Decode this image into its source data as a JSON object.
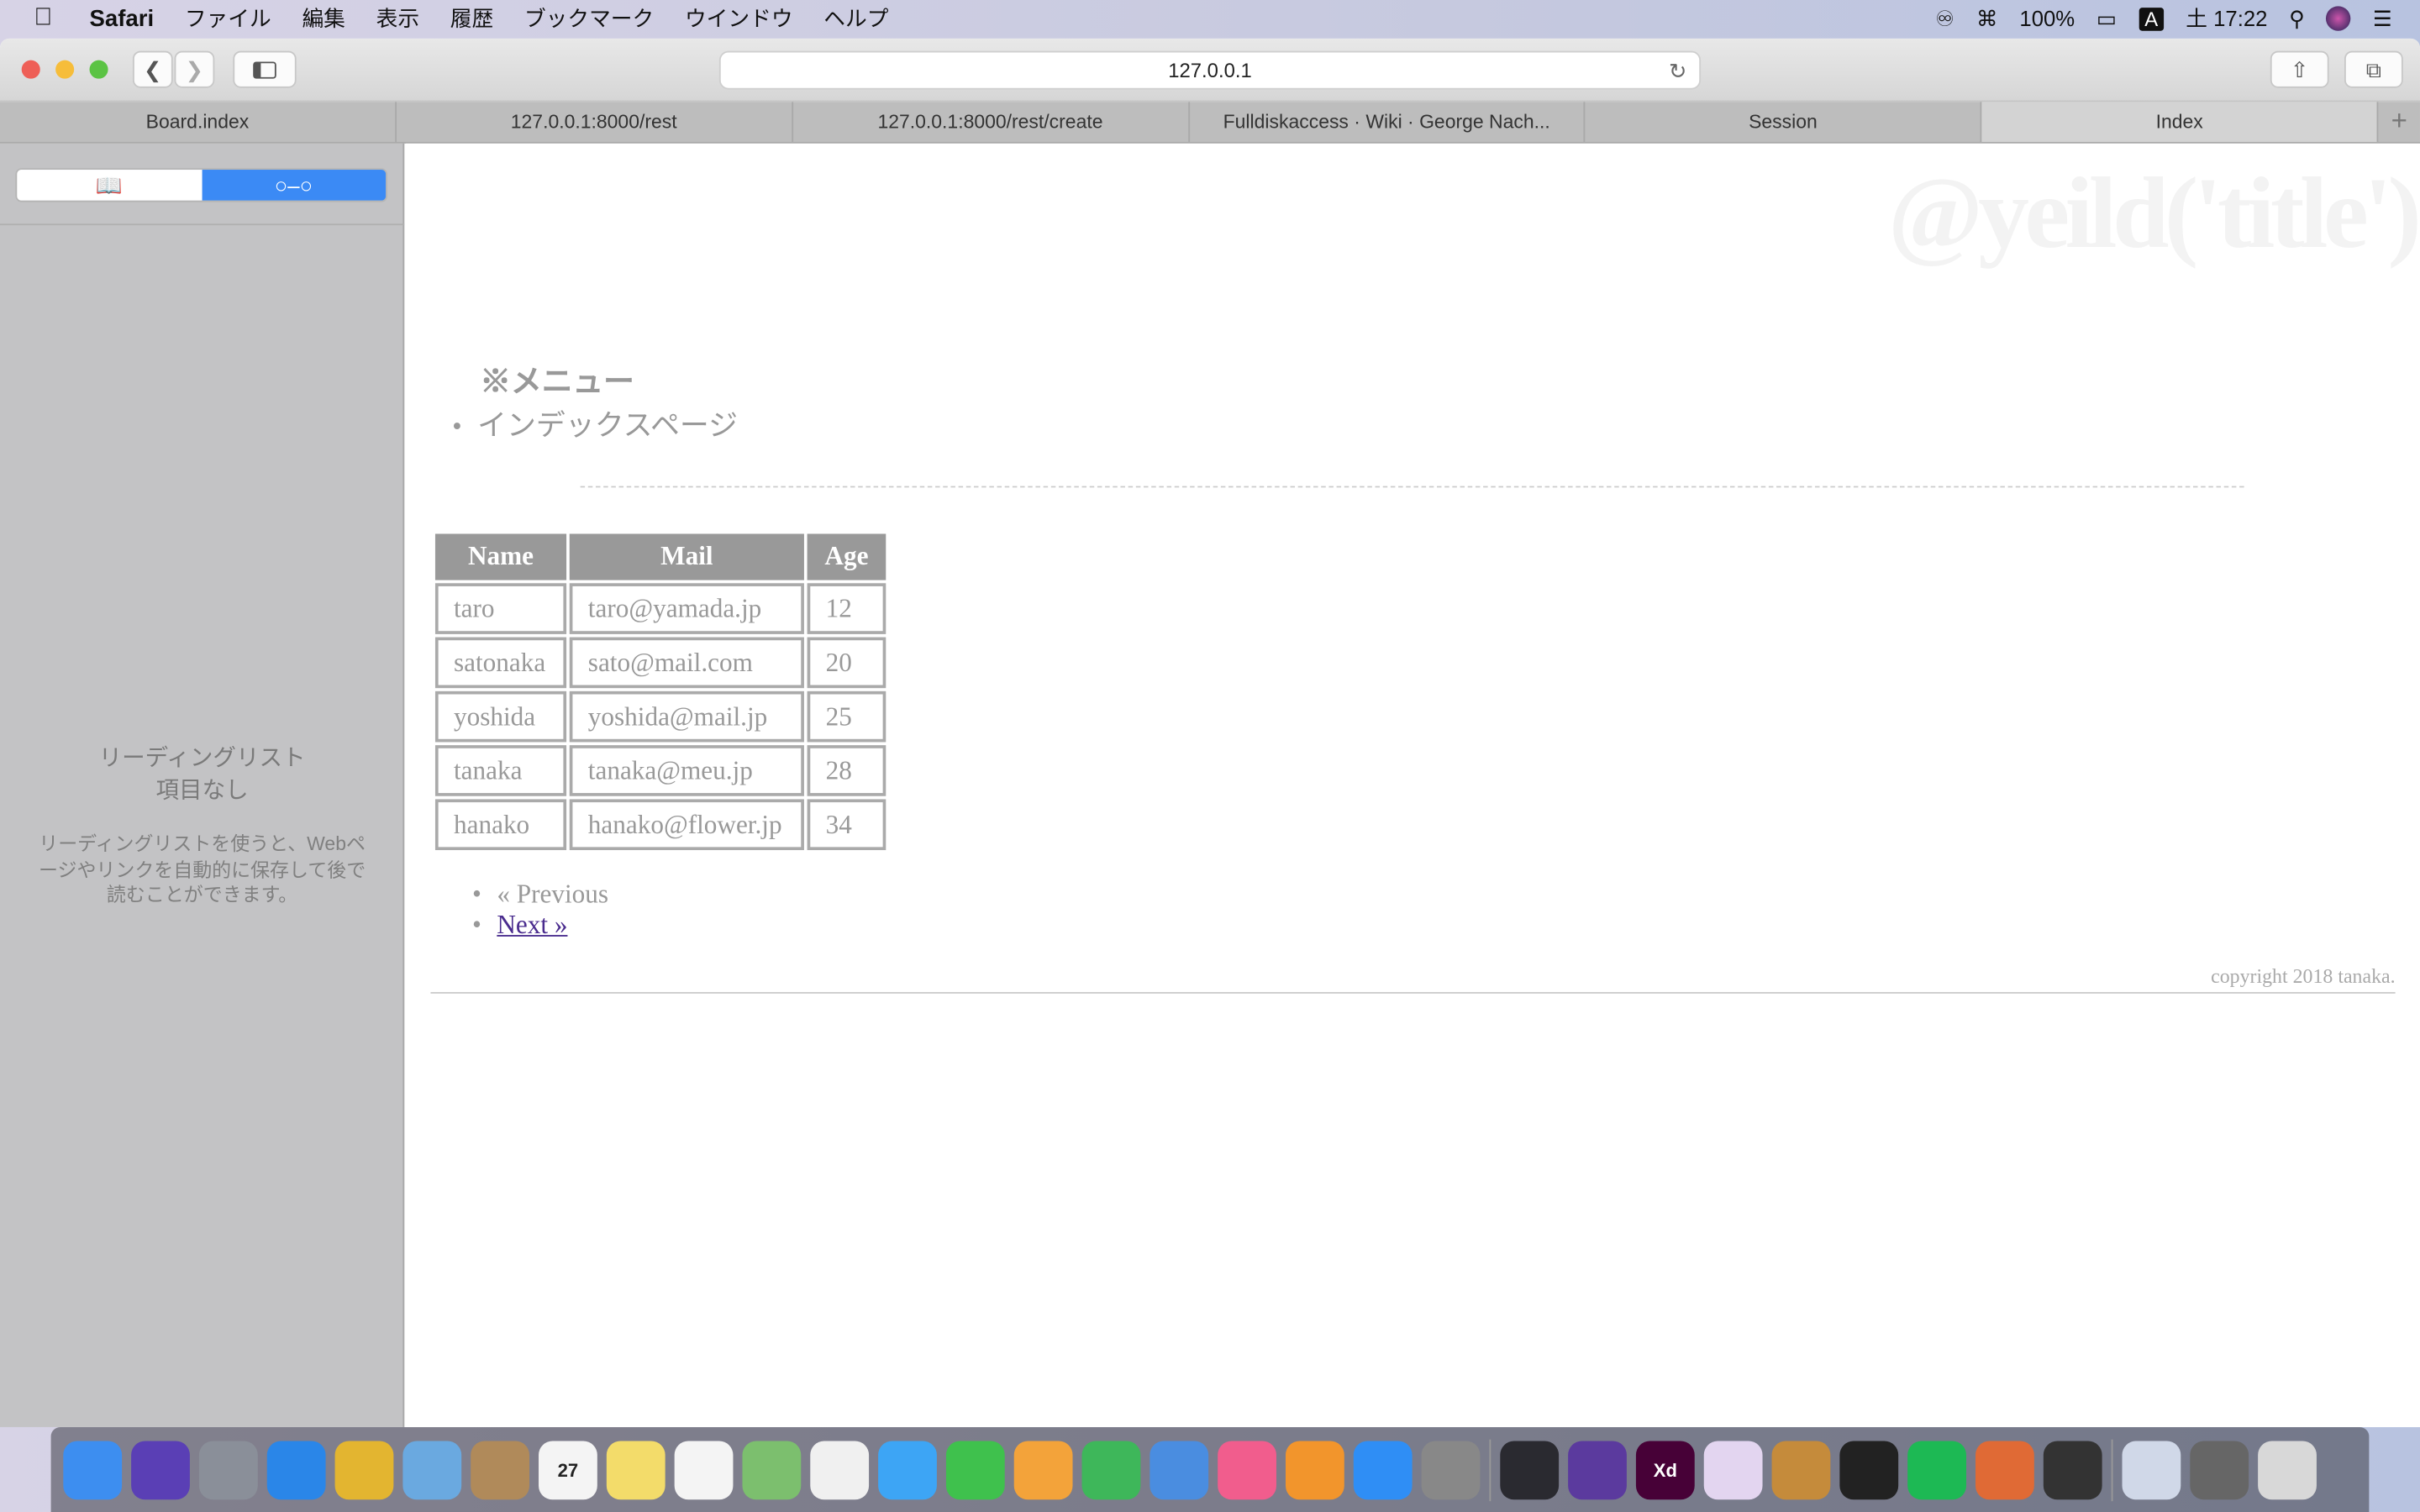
{
  "menubar": {
    "app": "Safari",
    "items": [
      "ファイル",
      "編集",
      "表示",
      "履歴",
      "ブックマーク",
      "ウインドウ",
      "ヘルプ"
    ],
    "battery": "100%",
    "ime": "A",
    "clock": "土 17:22"
  },
  "toolbar": {
    "url": "127.0.0.1"
  },
  "tabs": [
    {
      "label": "Board.index"
    },
    {
      "label": "127.0.0.1:8000/rest"
    },
    {
      "label": "127.0.0.1:8000/rest/create"
    },
    {
      "label": "Fulldiskaccess · Wiki · George Nach..."
    },
    {
      "label": "Session"
    },
    {
      "label": "Index",
      "active": true
    }
  ],
  "sidebar": {
    "title": "リーディングリスト",
    "subtitle": "項目なし",
    "description": "リーディングリストを使うと、Webページやリンクを自動的に保存して後で読むことができます。"
  },
  "page": {
    "title": "@yeild('title')",
    "menu_heading": "※メニュー",
    "menu_items": [
      "インデックスページ"
    ],
    "table": {
      "headers": [
        "Name",
        "Mail",
        "Age"
      ],
      "rows": [
        [
          "taro",
          "taro@yamada.jp",
          "12"
        ],
        [
          "satonaka",
          "sato@mail.com",
          "20"
        ],
        [
          "yoshida",
          "yoshida@mail.jp",
          "25"
        ],
        [
          "tanaka",
          "tanaka@meu.jp",
          "28"
        ],
        [
          "hanako",
          "hanako@flower.jp",
          "34"
        ]
      ]
    },
    "pager": {
      "previous": "« Previous",
      "next": "Next »"
    },
    "copyright": "copyright 2018 tanaka."
  },
  "dock": [
    {
      "name": "finder",
      "color": "#3d8ef0"
    },
    {
      "name": "siri",
      "color": "#5a3fb5"
    },
    {
      "name": "launchpad",
      "color": "#8a8f99"
    },
    {
      "name": "safari",
      "color": "#2a86e8"
    },
    {
      "name": "chrome",
      "color": "#e3b530"
    },
    {
      "name": "mail",
      "color": "#6aa9e0"
    },
    {
      "name": "contacts",
      "color": "#b08a5a"
    },
    {
      "name": "calendar",
      "color": "#f4f4f4",
      "label": "27"
    },
    {
      "name": "notes",
      "color": "#f3dc6a"
    },
    {
      "name": "reminders",
      "color": "#f4f4f4"
    },
    {
      "name": "maps",
      "color": "#7cbf6e"
    },
    {
      "name": "photos",
      "color": "#f0f0f0"
    },
    {
      "name": "messages",
      "color": "#3da5f5"
    },
    {
      "name": "facetime",
      "color": "#3fc14d"
    },
    {
      "name": "pages",
      "color": "#f3a33a"
    },
    {
      "name": "numbers",
      "color": "#3eb75a"
    },
    {
      "name": "keynote",
      "color": "#4a8de0"
    },
    {
      "name": "itunes",
      "color": "#f15d8d"
    },
    {
      "name": "books",
      "color": "#f2952c"
    },
    {
      "name": "app-store",
      "color": "#2f8ef5"
    },
    {
      "name": "system-preferences",
      "color": "#888"
    },
    {
      "name": "vscode",
      "color": "#2a2a30"
    },
    {
      "name": "visual-studio",
      "color": "#5b3a9e"
    },
    {
      "name": "adobe-xd",
      "color": "#470137",
      "label": "Xd"
    },
    {
      "name": "graphql",
      "color": "#e3d5f0"
    },
    {
      "name": "garageband",
      "color": "#c58b3b"
    },
    {
      "name": "terminal",
      "color": "#222"
    },
    {
      "name": "spotify",
      "color": "#1db954"
    },
    {
      "name": "keyboard-app",
      "color": "#e06a35"
    },
    {
      "name": "console",
      "color": "#333"
    },
    {
      "name": "preview",
      "color": "#d0d8e8"
    },
    {
      "name": "server",
      "color": "#666"
    },
    {
      "name": "trash",
      "color": "#d8d8d8"
    }
  ]
}
